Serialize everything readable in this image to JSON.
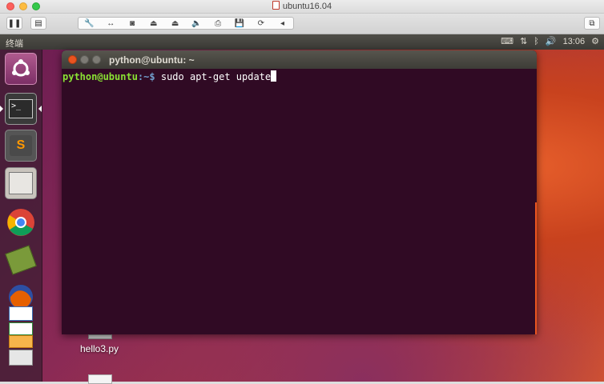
{
  "host": {
    "title": "ubuntu16.04"
  },
  "panel": {
    "app_name": "终端",
    "time": "13:06"
  },
  "terminal": {
    "title": "python@ubuntu: ~",
    "prompt_user": "python@ubuntu",
    "prompt_path": ":~$",
    "command": "sudo apt-get update"
  },
  "launcher": {
    "items": [
      "ubuntu-dash",
      "terminal",
      "sublime-text",
      "files",
      "chrome",
      "books",
      "firefox",
      "libreoffice-writer",
      "libreoffice-calc",
      "libreoffice-impress",
      "software"
    ]
  },
  "desktop": {
    "files": [
      {
        "label": "hello3.py"
      },
      {
        "label": ""
      }
    ]
  },
  "colors": {
    "terminal_bg": "#300a24",
    "prompt_user": "#8ae234",
    "prompt_path": "#729fcf",
    "accent": "#e95420"
  }
}
